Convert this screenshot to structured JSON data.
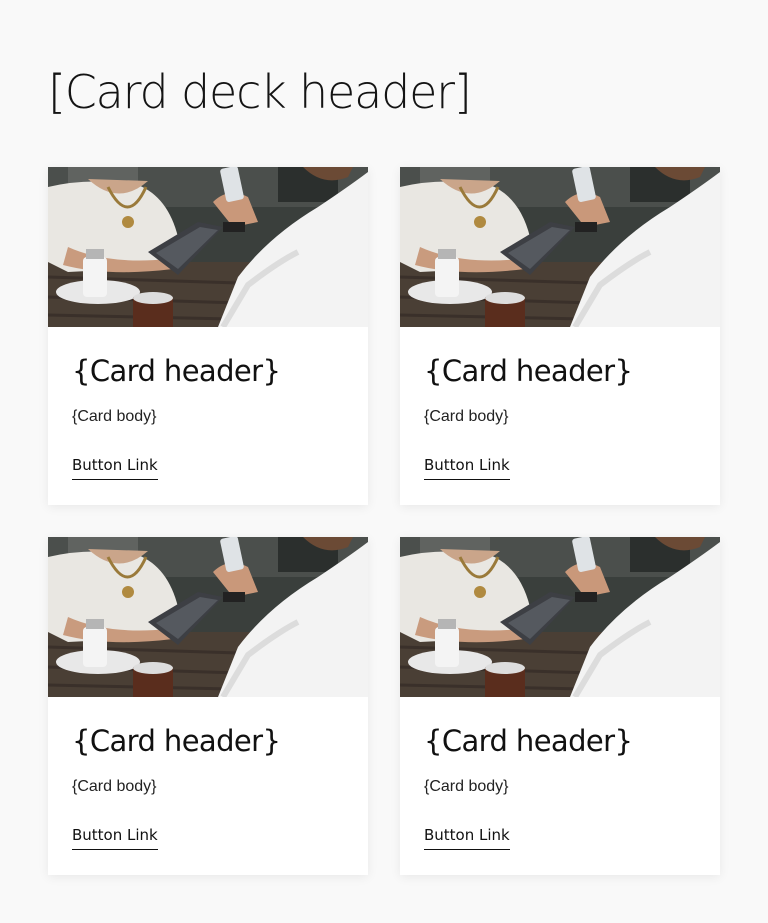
{
  "deck": {
    "header": "[Card deck header]"
  },
  "cards": [
    {
      "header": "{Card header}",
      "body": "{Card body}",
      "link_label": "Button Link"
    },
    {
      "header": "{Card header}",
      "body": "{Card body}",
      "link_label": "Button Link"
    },
    {
      "header": "{Card header}",
      "body": "{Card body}",
      "link_label": "Button Link"
    },
    {
      "header": "{Card header}",
      "body": "{Card body}",
      "link_label": "Button Link"
    }
  ],
  "colors": {
    "page_background": "#f9f9f9",
    "card_background": "#ffffff",
    "text": "#111111"
  }
}
